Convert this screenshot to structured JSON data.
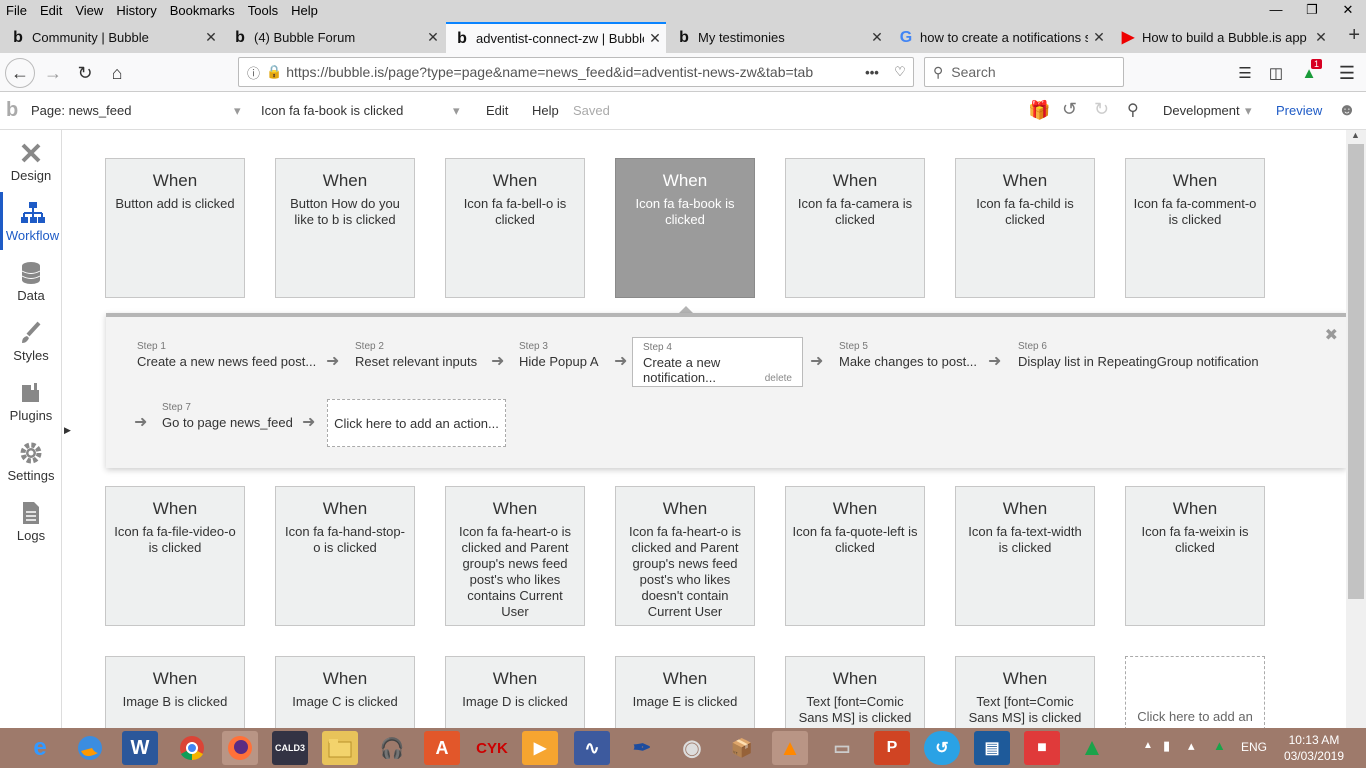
{
  "menu": [
    "File",
    "Edit",
    "View",
    "History",
    "Bookmarks",
    "Tools",
    "Help"
  ],
  "tabs": [
    {
      "title": "Community | Bubble"
    },
    {
      "title": "(4) Bubble Forum"
    },
    {
      "title": "adventist-connect-zw | Bubble"
    },
    {
      "title": "My testimonies"
    },
    {
      "title": "how to create a notifications sy"
    },
    {
      "title": "How to build a Bubble.is app -"
    }
  ],
  "url": "https://bubble.is/page?type=page&name=news_feed&id=adventist-news-zw&tab=tab",
  "search_placeholder": "Search",
  "notif_count": "1",
  "bubblebar": {
    "page": "Page: news_feed",
    "event": "Icon fa fa-book is clicked",
    "edit": "Edit",
    "help": "Help",
    "saved": "Saved",
    "env": "Development",
    "preview": "Preview"
  },
  "sidebar": [
    {
      "label": "Design"
    },
    {
      "label": "Workflow"
    },
    {
      "label": "Data"
    },
    {
      "label": "Styles"
    },
    {
      "label": "Plugins"
    },
    {
      "label": "Settings"
    },
    {
      "label": "Logs"
    }
  ],
  "when_label": "When",
  "row1": [
    {
      "desc": "Button add is clicked"
    },
    {
      "desc": "Button How do you like to b is clicked"
    },
    {
      "desc": "Icon fa fa-bell-o is clicked"
    },
    {
      "desc": "Icon fa fa-book is clicked"
    },
    {
      "desc": "Icon fa fa-camera is clicked"
    },
    {
      "desc": "Icon fa fa-child is clicked"
    },
    {
      "desc": "Icon fa fa-comment-o is clicked"
    }
  ],
  "steps": [
    {
      "num": "Step 1",
      "text": "Create a new news feed post..."
    },
    {
      "num": "Step 2",
      "text": "Reset relevant inputs"
    },
    {
      "num": "Step 3",
      "text": "Hide Popup A"
    },
    {
      "num": "Step 4",
      "text": "Create a new notification...",
      "delete": "delete"
    },
    {
      "num": "Step 5",
      "text": "Make changes to post..."
    },
    {
      "num": "Step 6",
      "text": "Display list in RepeatingGroup notification"
    },
    {
      "num": "Step 7",
      "text": "Go to page news_feed"
    }
  ],
  "add_action": "Click here to add an action...",
  "row2": [
    {
      "desc": "Icon fa fa-file-video-o is clicked"
    },
    {
      "desc": "Icon fa fa-hand-stop-o is clicked"
    },
    {
      "desc": "Icon fa fa-heart-o is clicked and Parent group's news feed post's who likes contains Current User"
    },
    {
      "desc": "Icon fa fa-heart-o is clicked and Parent group's news feed post's who likes doesn't contain Current User"
    },
    {
      "desc": "Icon fa fa-quote-left is clicked"
    },
    {
      "desc": "Icon fa fa-text-width is clicked"
    },
    {
      "desc": "Icon fa fa-weixin is clicked"
    }
  ],
  "row3": [
    {
      "desc": "Image B is clicked"
    },
    {
      "desc": "Image C is clicked"
    },
    {
      "desc": "Image D is clicked"
    },
    {
      "desc": "Image E is clicked"
    },
    {
      "desc": "Text [font=Comic Sans MS] is clicked"
    },
    {
      "desc": "Text [font=Comic Sans MS] is clicked"
    }
  ],
  "add_event": "Click here to add an",
  "taskbar": {
    "lang": "ENG",
    "time": "10:13 AM",
    "date": "03/03/2019"
  },
  "colors": {
    "accent": "#1e5bc6",
    "taskbar": "#9e7a6b",
    "selected_card": "#9b9b9b"
  }
}
